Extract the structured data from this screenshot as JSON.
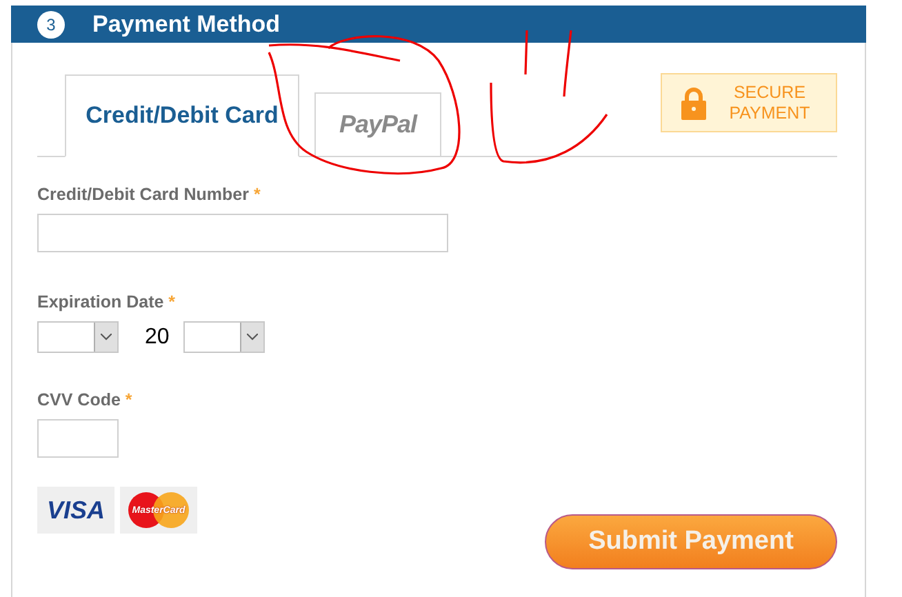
{
  "header": {
    "step": "3",
    "title": "Payment Method"
  },
  "tabs": [
    {
      "label": "Credit/Debit Card",
      "kind": "text",
      "selected": true
    },
    {
      "label": "PayPal",
      "kind": "logo",
      "selected": false
    }
  ],
  "secure_badge": {
    "label": "SECURE PAYMENT"
  },
  "fields": [
    {
      "label": "Credit/Debit Card Number",
      "required": "*",
      "kind": "wide"
    },
    {
      "label": "Expiration Date",
      "required": "*",
      "kind": "date",
      "prefix": "20"
    },
    {
      "label": "CVV Code",
      "required": "*",
      "kind": "short"
    }
  ],
  "card_logos": [
    {
      "label": "VISA",
      "kind": "visa"
    },
    {
      "label": "MasterCard",
      "kind": "mastercard"
    }
  ],
  "submit": {
    "label": "Submit Payment"
  }
}
